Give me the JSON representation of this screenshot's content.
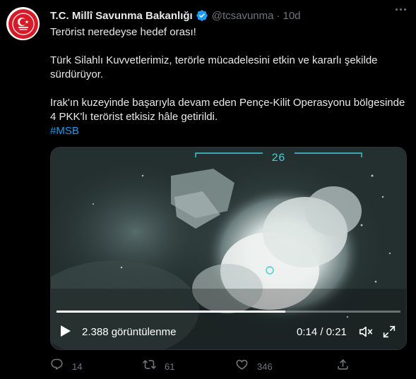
{
  "tweet": {
    "author_name": "T.C. Millî Savunma Bakanlığı",
    "handle": "@tcsavunma",
    "separator": "·",
    "time": "10d",
    "paragraph_1": "Terörist neredeyse hedef orası!",
    "paragraph_2a": "Türk Silahlı Kuvvetlerimiz, terörle mücadelesini etkin ve kararlı şekilde",
    "paragraph_2b": "sürdürüyor.",
    "paragraph_3a": "Irak'ın kuzeyinde başarıyla devam eden Pençe-Kilit Operasyonu bölgesinde",
    "paragraph_3b": "4 PKK'lı terörist etkisiz hâle getirildi.",
    "hashtag": "#MSB"
  },
  "video": {
    "hud_number": "26",
    "views_label": "2.388 görüntülenme",
    "time_label": "0:14 / 0:21",
    "progress_fraction": 0.665
  },
  "actions": {
    "reply_count": "14",
    "retweet_count": "61",
    "like_count": "346"
  },
  "colors": {
    "background": "#000000",
    "text": "#e7e9ea",
    "muted": "#71767b",
    "link": "#1d9bf0",
    "verified": "#1d9bf0",
    "emblem_red": "#d71a28",
    "hud_cyan": "#3fd0d4"
  },
  "icons": {
    "verified": "verified-badge-icon",
    "more": "more-options-icon",
    "play": "play-icon",
    "volume": "volume-icon",
    "fullscreen": "fullscreen-icon",
    "reply": "reply-icon",
    "retweet": "retweet-icon",
    "like": "heart-icon",
    "share": "share-icon"
  }
}
